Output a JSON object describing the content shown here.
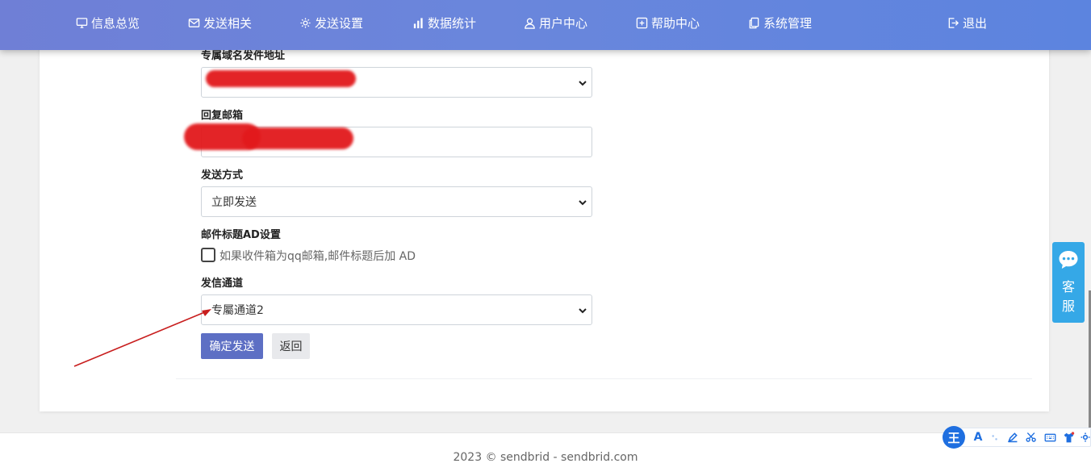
{
  "nav": {
    "items": [
      {
        "label": "信息总览",
        "icon": "monitor-icon"
      },
      {
        "label": "发送相关",
        "icon": "mail-icon"
      },
      {
        "label": "发送设置",
        "icon": "gear-icon"
      },
      {
        "label": "数据统计",
        "icon": "bar-chart-icon"
      },
      {
        "label": "用户中心",
        "icon": "user-icon"
      },
      {
        "label": "帮助中心",
        "icon": "help-plus-icon"
      },
      {
        "label": "系统管理",
        "icon": "copy-icon"
      }
    ],
    "logout_label": "退出",
    "accent": "#6a86dc"
  },
  "form": {
    "sender_domain_label": "专属域名发件地址",
    "reply_email_label": "回复邮箱",
    "send_mode_label": "发送方式",
    "send_mode_value": "立即发送",
    "subject_ad_label": "邮件标题AD设置",
    "subject_ad_checkbox_text": "如果收件箱为qq邮箱,邮件标题后加 AD",
    "subject_ad_checked": false,
    "channel_label": "发信通道",
    "channel_value": "专屬通道2",
    "confirm_button": "确定发送",
    "back_button": "返回"
  },
  "customer_service": {
    "text_line1": "客",
    "text_line2": "服",
    "icon": "chat-bubble-icon",
    "color": "#35a8e7"
  },
  "ime_toolbar": {
    "logo_text": "王",
    "letter_icon": "A",
    "color": "#1f6fe0"
  },
  "footer": {
    "text": "2023 © sendbrid - sendbrid.com"
  }
}
